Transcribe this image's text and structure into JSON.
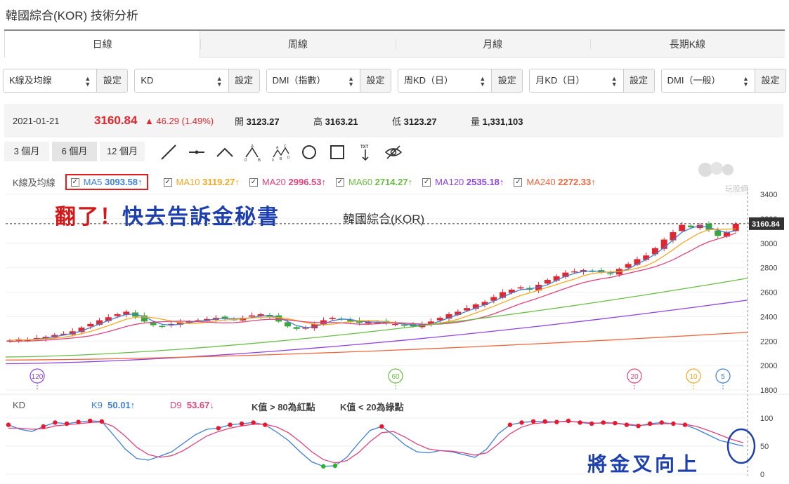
{
  "page_title": "韓國綜合(KOR) 技術分析",
  "tabs": [
    {
      "label": "日線",
      "active": true
    },
    {
      "label": "周線",
      "active": false
    },
    {
      "label": "月線",
      "active": false
    },
    {
      "label": "長期K線",
      "active": false
    }
  ],
  "selectors": [
    {
      "value": "K線及均線",
      "button": "設定"
    },
    {
      "value": "KD",
      "button": "設定"
    },
    {
      "value": "DMI（指數）",
      "button": "設定"
    },
    {
      "value": "周KD（日）",
      "button": "設定"
    },
    {
      "value": "月KD（日）",
      "button": "設定"
    },
    {
      "value": "DMI（一般）",
      "button": "設定"
    }
  ],
  "quote": {
    "date": "2021-01-21",
    "price": "3160.84",
    "change": "▲ 46.29 (1.49%)",
    "open_label": "開",
    "open": "3123.27",
    "high_label": "高",
    "high": "3163.21",
    "low_label": "低",
    "low": "3123.27",
    "vol_label": "量",
    "vol": "1,331,103"
  },
  "ranges": [
    {
      "label": "3 個月",
      "active": false
    },
    {
      "label": "6 個月",
      "active": true
    },
    {
      "label": "12 個月",
      "active": false
    }
  ],
  "ma_legend": {
    "label": "K線及均線",
    "items": [
      {
        "name": "MA5",
        "value": "3093.58↑",
        "color": "#3d7fd6"
      },
      {
        "name": "MA10",
        "value": "3119.27↑",
        "color": "#f5a623"
      },
      {
        "name": "MA20",
        "value": "2996.53↑",
        "color": "#e0427a"
      },
      {
        "name": "MA60",
        "value": "2714.27↑",
        "color": "#6abd45"
      },
      {
        "name": "MA120",
        "value": "2535.18↑",
        "color": "#8e44e0"
      },
      {
        "name": "MA240",
        "value": "2272.33↑",
        "color": "#f0653a"
      }
    ]
  },
  "chart_title": "韓國綜合(KOR)",
  "watermark": "玩股網",
  "last_price_tag": "3160.84",
  "annotation_top": {
    "red": "翻了！",
    "blue": "快去告訴金秘書"
  },
  "annotation_bottom": "將金叉向上",
  "kd_legend": {
    "label": "KD",
    "k": {
      "name": "K9",
      "value": "50.01↑",
      "color": "#3d7fd6"
    },
    "d": {
      "name": "D9",
      "value": "53.67↓",
      "color": "#e0427a"
    },
    "note1": "K值 > 80為紅點",
    "note2": "K值 < 20為綠點"
  },
  "chart_data": [
    {
      "type": "candlestick",
      "title": "韓國綜合(KOR)",
      "y_ticks": [
        "3400",
        "3200",
        "3000",
        "2800",
        "2600",
        "2400",
        "2200",
        "2000",
        "1800"
      ],
      "ylim": [
        1800,
        3400
      ],
      "ma_markers": [
        "120",
        "60",
        "20",
        "10",
        "5"
      ],
      "series_close": [
        2205,
        2215,
        2210,
        2225,
        2235,
        2250,
        2260,
        2280,
        2310,
        2340,
        2370,
        2395,
        2420,
        2440,
        2400,
        2360,
        2330,
        2320,
        2340,
        2355,
        2360,
        2370,
        2380,
        2390,
        2385,
        2375,
        2390,
        2410,
        2420,
        2400,
        2360,
        2320,
        2300,
        2310,
        2340,
        2370,
        2390,
        2380,
        2360,
        2350,
        2360,
        2355,
        2345,
        2340,
        2330,
        2320,
        2340,
        2360,
        2390,
        2420,
        2440,
        2470,
        2500,
        2520,
        2560,
        2600,
        2620,
        2640,
        2620,
        2660,
        2700,
        2730,
        2760,
        2770,
        2780,
        2770,
        2760,
        2750,
        2790,
        2830,
        2870,
        2900,
        2960,
        3030,
        3090,
        3150,
        3130,
        3150,
        3110,
        3060,
        3090,
        3160
      ]
    },
    {
      "type": "line",
      "title": "KD",
      "y_ticks": [
        "100",
        "50",
        "0"
      ],
      "ylim": [
        0,
        100
      ],
      "series": [
        {
          "name": "K9",
          "values": [
            88,
            80,
            76,
            85,
            92,
            90,
            93,
            95,
            94,
            70,
            45,
            28,
            25,
            32,
            40,
            55,
            70,
            80,
            82,
            88,
            90,
            92,
            88,
            75,
            60,
            40,
            22,
            14,
            15,
            30,
            55,
            78,
            85,
            70,
            52,
            40,
            38,
            42,
            40,
            35,
            30,
            45,
            72,
            88,
            92,
            94,
            94,
            93,
            95,
            92,
            90,
            92,
            91,
            88,
            86,
            90,
            92,
            90,
            88,
            80,
            70,
            60,
            55,
            50
          ]
        },
        {
          "name": "D9",
          "values": [
            82,
            82,
            80,
            81,
            86,
            88,
            90,
            92,
            93,
            85,
            68,
            48,
            35,
            30,
            33,
            42,
            55,
            68,
            76,
            82,
            86,
            89,
            89,
            84,
            74,
            58,
            40,
            26,
            20,
            24,
            38,
            58,
            74,
            76,
            66,
            54,
            45,
            42,
            41,
            38,
            34,
            38,
            54,
            72,
            84,
            90,
            92,
            93,
            94,
            93,
            91,
            91,
            91,
            89,
            87,
            88,
            90,
            90,
            89,
            85,
            78,
            70,
            62,
            56
          ]
        }
      ]
    }
  ]
}
